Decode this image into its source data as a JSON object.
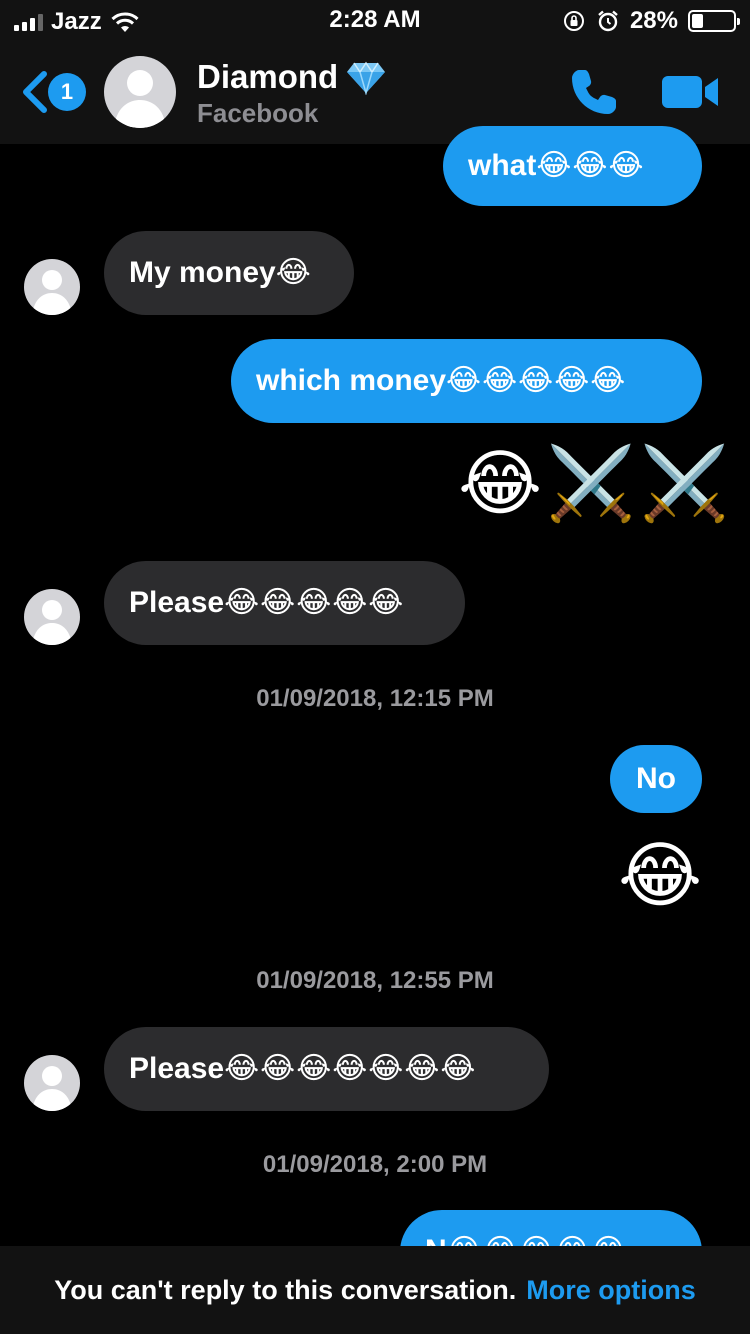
{
  "status_bar": {
    "carrier": "Jazz",
    "time": "2:28 AM",
    "battery_percent": "28%",
    "battery_level": 0.28,
    "icons": [
      "signal-icon",
      "wifi-icon",
      "rotation-lock-icon",
      "alarm-icon",
      "battery-icon"
    ]
  },
  "header": {
    "back_badge": "1",
    "name": "Diamond",
    "name_emoji": "diamond-icon",
    "subtitle": "Facebook",
    "actions": [
      "phone-icon",
      "video-icon"
    ]
  },
  "messages": {
    "m1_text": "what ",
    "m1_emoji": "😂😂😂",
    "m2_text": "My money",
    "m2_emoji": "😂",
    "m3_text": "which money ",
    "m3_emoji": "😂😂😂😂😂",
    "m4_big": "😂⚔️⚔️",
    "m5_text": "Please",
    "m5_emoji": "😂😂😂😂😂",
    "ts1": "01/09/2018, 12:15 PM",
    "m6_text": "No",
    "m7_big": "😂",
    "ts2": "01/09/2018, 12:55 PM",
    "m8_text": "Please",
    "m8_emoji": "😂😂😂😂😂😂😂",
    "ts3": "01/09/2018, 2:00 PM",
    "m9_text": "N",
    "m9_emoji": "😂😂😂😂😂"
  },
  "footer": {
    "notice": "You can't reply to this conversation.",
    "link": "More options"
  },
  "colors": {
    "accent": "#1d9bf0",
    "incoming_bubble": "#2c2c2e",
    "bar_background": "#121212",
    "background": "#000000"
  }
}
